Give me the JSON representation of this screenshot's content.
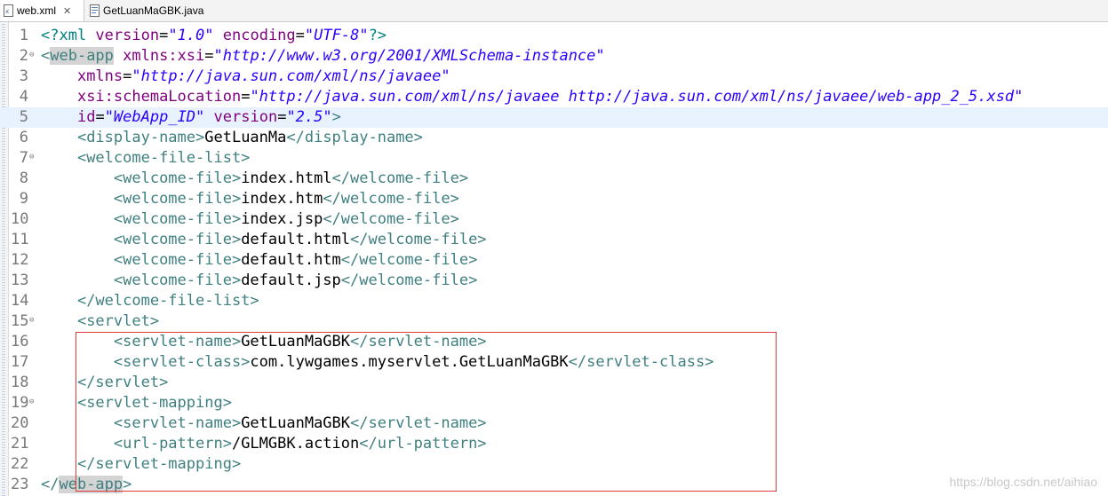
{
  "tabs": [
    {
      "label": "web.xml",
      "active": true,
      "icon": "xml-file-icon",
      "close_glyph": "✕"
    },
    {
      "label": "GetLuanMaGBK.java",
      "active": false,
      "icon": "java-file-icon"
    }
  ],
  "editor": {
    "lines": [
      {
        "num": "1",
        "fold": "",
        "tokens": [
          {
            "c": "t-pi",
            "t": "<?xml "
          },
          {
            "c": "t-attr",
            "t": "version"
          },
          {
            "c": "t-eq",
            "t": "="
          },
          {
            "c": "t-val",
            "t": "\"1.0\""
          },
          {
            "c": "t-pi",
            "t": " "
          },
          {
            "c": "t-attr",
            "t": "encoding"
          },
          {
            "c": "t-eq",
            "t": "="
          },
          {
            "c": "t-val",
            "t": "\"UTF-8\""
          },
          {
            "c": "t-pi",
            "t": "?>"
          }
        ]
      },
      {
        "num": "2",
        "fold": "⊖",
        "tokens": [
          {
            "c": "t-tag",
            "t": "<"
          },
          {
            "c": "t-tag hl-tag",
            "t": "web-app"
          },
          {
            "c": "t-tag",
            "t": " "
          },
          {
            "c": "t-attr",
            "t": "xmlns:xsi"
          },
          {
            "c": "t-eq",
            "t": "="
          },
          {
            "c": "t-val",
            "t": "\"http://www.w3.org/2001/XMLSchema-instance\""
          }
        ]
      },
      {
        "num": "3",
        "fold": "",
        "tokens": [
          {
            "c": "t-txt",
            "t": "    "
          },
          {
            "c": "t-attr",
            "t": "xmlns"
          },
          {
            "c": "t-eq",
            "t": "="
          },
          {
            "c": "t-val",
            "t": "\"http://java.sun.com/xml/ns/javaee\""
          }
        ]
      },
      {
        "num": "4",
        "fold": "",
        "tokens": [
          {
            "c": "t-txt",
            "t": "    "
          },
          {
            "c": "t-attr",
            "t": "xsi:schemaLocation"
          },
          {
            "c": "t-eq",
            "t": "="
          },
          {
            "c": "t-val",
            "t": "\"http://java.sun.com/xml/ns/javaee http://java.sun.com/xml/ns/javaee/web-app_2_5.xsd\""
          }
        ]
      },
      {
        "num": "5",
        "fold": "",
        "current": true,
        "tokens": [
          {
            "c": "t-txt",
            "t": "    "
          },
          {
            "c": "t-attr",
            "t": "id"
          },
          {
            "c": "t-eq",
            "t": "="
          },
          {
            "c": "t-val",
            "t": "\"WebApp_ID\""
          },
          {
            "c": "t-txt",
            "t": " "
          },
          {
            "c": "t-attr",
            "t": "version"
          },
          {
            "c": "t-eq",
            "t": "="
          },
          {
            "c": "t-val",
            "t": "\"2.5\""
          },
          {
            "c": "t-tag",
            "t": ">"
          }
        ]
      },
      {
        "num": "6",
        "fold": "",
        "tokens": [
          {
            "c": "t-txt",
            "t": "    "
          },
          {
            "c": "t-tag",
            "t": "<display-name>"
          },
          {
            "c": "t-txt",
            "t": "GetLuanMa"
          },
          {
            "c": "t-tag",
            "t": "</display-name>"
          }
        ]
      },
      {
        "num": "7",
        "fold": "⊖",
        "tokens": [
          {
            "c": "t-txt",
            "t": "    "
          },
          {
            "c": "t-tag",
            "t": "<welcome-file-list>"
          }
        ]
      },
      {
        "num": "8",
        "fold": "",
        "tokens": [
          {
            "c": "t-txt",
            "t": "        "
          },
          {
            "c": "t-tag",
            "t": "<welcome-file>"
          },
          {
            "c": "t-txt",
            "t": "index.html"
          },
          {
            "c": "t-tag",
            "t": "</welcome-file>"
          }
        ]
      },
      {
        "num": "9",
        "fold": "",
        "tokens": [
          {
            "c": "t-txt",
            "t": "        "
          },
          {
            "c": "t-tag",
            "t": "<welcome-file>"
          },
          {
            "c": "t-txt",
            "t": "index.htm"
          },
          {
            "c": "t-tag",
            "t": "</welcome-file>"
          }
        ]
      },
      {
        "num": "10",
        "fold": "",
        "tokens": [
          {
            "c": "t-txt",
            "t": "        "
          },
          {
            "c": "t-tag",
            "t": "<welcome-file>"
          },
          {
            "c": "t-txt",
            "t": "index.jsp"
          },
          {
            "c": "t-tag",
            "t": "</welcome-file>"
          }
        ]
      },
      {
        "num": "11",
        "fold": "",
        "tokens": [
          {
            "c": "t-txt",
            "t": "        "
          },
          {
            "c": "t-tag",
            "t": "<welcome-file>"
          },
          {
            "c": "t-txt",
            "t": "default.html"
          },
          {
            "c": "t-tag",
            "t": "</welcome-file>"
          }
        ]
      },
      {
        "num": "12",
        "fold": "",
        "tokens": [
          {
            "c": "t-txt",
            "t": "        "
          },
          {
            "c": "t-tag",
            "t": "<welcome-file>"
          },
          {
            "c": "t-txt",
            "t": "default.htm"
          },
          {
            "c": "t-tag",
            "t": "</welcome-file>"
          }
        ]
      },
      {
        "num": "13",
        "fold": "",
        "tokens": [
          {
            "c": "t-txt",
            "t": "        "
          },
          {
            "c": "t-tag",
            "t": "<welcome-file>"
          },
          {
            "c": "t-txt",
            "t": "default.jsp"
          },
          {
            "c": "t-tag",
            "t": "</welcome-file>"
          }
        ]
      },
      {
        "num": "14",
        "fold": "",
        "tokens": [
          {
            "c": "t-txt",
            "t": "    "
          },
          {
            "c": "t-tag",
            "t": "</welcome-file-list>"
          }
        ]
      },
      {
        "num": "15",
        "fold": "⊖",
        "tokens": [
          {
            "c": "t-txt",
            "t": "    "
          },
          {
            "c": "t-tag",
            "t": "<servlet>"
          }
        ]
      },
      {
        "num": "16",
        "fold": "",
        "tokens": [
          {
            "c": "t-txt",
            "t": "        "
          },
          {
            "c": "t-tag",
            "t": "<servlet-name>"
          },
          {
            "c": "t-txt",
            "t": "GetLuanMaGBK"
          },
          {
            "c": "t-tag",
            "t": "</servlet-name>"
          }
        ]
      },
      {
        "num": "17",
        "fold": "",
        "tokens": [
          {
            "c": "t-txt",
            "t": "        "
          },
          {
            "c": "t-tag",
            "t": "<servlet-class>"
          },
          {
            "c": "t-txt",
            "t": "com.lywgames.myservlet.GetLuanMaGBK"
          },
          {
            "c": "t-tag",
            "t": "</servlet-class>"
          }
        ]
      },
      {
        "num": "18",
        "fold": "",
        "tokens": [
          {
            "c": "t-txt",
            "t": "    "
          },
          {
            "c": "t-tag",
            "t": "</servlet>"
          }
        ]
      },
      {
        "num": "19",
        "fold": "⊖",
        "tokens": [
          {
            "c": "t-txt",
            "t": "    "
          },
          {
            "c": "t-tag",
            "t": "<servlet-mapping>"
          }
        ]
      },
      {
        "num": "20",
        "fold": "",
        "tokens": [
          {
            "c": "t-txt",
            "t": "        "
          },
          {
            "c": "t-tag",
            "t": "<servlet-name>"
          },
          {
            "c": "t-txt",
            "t": "GetLuanMaGBK"
          },
          {
            "c": "t-tag",
            "t": "</servlet-name>"
          }
        ]
      },
      {
        "num": "21",
        "fold": "",
        "tokens": [
          {
            "c": "t-txt",
            "t": "        "
          },
          {
            "c": "t-tag",
            "t": "<url-pattern>"
          },
          {
            "c": "t-txt",
            "t": "/GLMGBK.action"
          },
          {
            "c": "t-tag",
            "t": "</url-pattern>"
          }
        ]
      },
      {
        "num": "22",
        "fold": "",
        "tokens": [
          {
            "c": "t-txt",
            "t": "    "
          },
          {
            "c": "t-tag",
            "t": "</servlet-mapping>"
          }
        ]
      },
      {
        "num": "23",
        "fold": "",
        "tokens": [
          {
            "c": "t-tag",
            "t": "</"
          },
          {
            "c": "t-tag hl-tag",
            "t": "web-app"
          },
          {
            "c": "t-tag",
            "t": ">"
          }
        ]
      }
    ]
  },
  "watermark": "https://blog.csdn.net/aihiao",
  "colors": {
    "highlight_box": "#e0393c",
    "current_line": "#e8f2fe"
  }
}
